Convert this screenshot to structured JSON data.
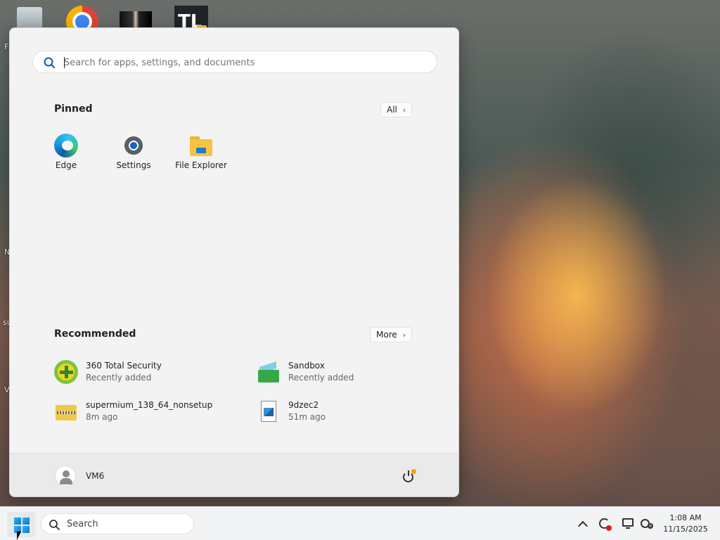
{
  "desktop": {
    "edge_labels": [
      "F",
      "N",
      "su",
      "V"
    ]
  },
  "start_menu": {
    "search": {
      "placeholder": "Search for apps, settings, and documents"
    },
    "pinned": {
      "title": "Pinned",
      "all_button": "All",
      "apps": [
        {
          "label": "Edge",
          "icon": "edge-icon"
        },
        {
          "label": "Settings",
          "icon": "gear-icon"
        },
        {
          "label": "File Explorer",
          "icon": "folder-icon"
        }
      ]
    },
    "recommended": {
      "title": "Recommended",
      "more_button": "More",
      "items": [
        {
          "name": "360 Total Security",
          "sub": "Recently added",
          "icon": "shield-plus-icon"
        },
        {
          "name": "Sandbox",
          "sub": "Recently added",
          "icon": "sandbox-icon"
        },
        {
          "name": "supermium_138_64_nonsetup",
          "sub": "8m ago",
          "icon": "zip-folder-icon"
        },
        {
          "name": "9dzec2",
          "sub": "51m ago",
          "icon": "image-file-icon"
        }
      ]
    },
    "footer": {
      "username": "VM6"
    }
  },
  "taskbar": {
    "search_label": "Search",
    "clock": {
      "time": "1:08 AM",
      "date": "11/15/2025"
    }
  },
  "colors": {
    "accent": "#0a72c7",
    "start_bg": "#f3f3f3",
    "taskbar_bg": "#f1f3f5"
  }
}
